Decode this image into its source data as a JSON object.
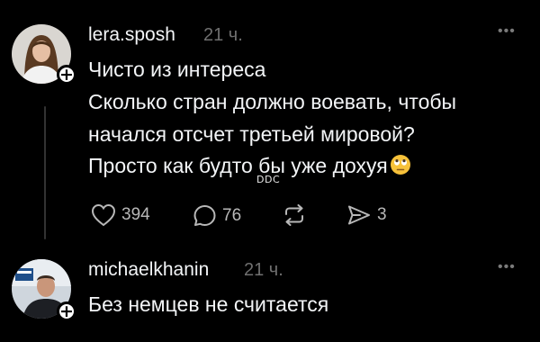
{
  "posts": [
    {
      "username": "lera.sposh",
      "time": "21 ч.",
      "lines": [
        "Чисто из интереса",
        "Сколько стран должно воевать, чтобы",
        "начался отсчет третьей мировой?",
        "Просто как будто бы уже дохуя"
      ],
      "trailing_emoji": "face-with-rolling-eyes",
      "actions": {
        "likes": "394",
        "replies": "76",
        "reposts": "",
        "shares": "3"
      },
      "watermark": "DDC"
    },
    {
      "username": "michaelkhanin",
      "time": "21 ч.",
      "lines": [
        "Без немцев не считается"
      ]
    }
  ],
  "icons": {
    "more": "more-horizontal-icon",
    "follow": "plus-icon",
    "like": "heart-icon",
    "reply": "comment-icon",
    "repost": "repost-icon",
    "share": "share-icon"
  },
  "colors": {
    "background": "#000000",
    "text": "#f3f5f7",
    "muted": "#6f6f6f",
    "icon": "#b8b8b8",
    "emoji": "#f7c23a"
  }
}
